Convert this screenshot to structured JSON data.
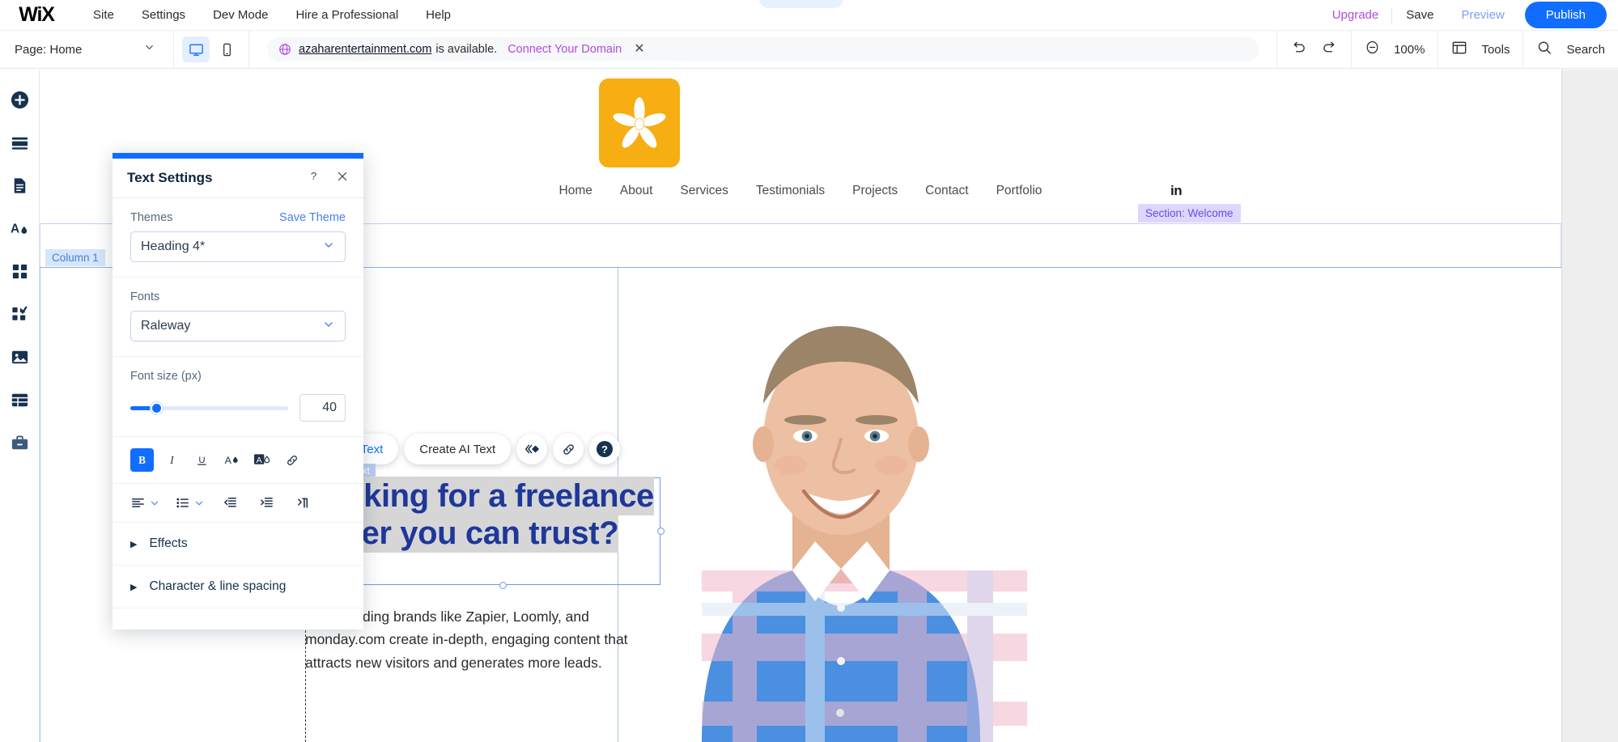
{
  "app": {
    "brand": "WiX",
    "accent_blue": "#116dff",
    "accent_purple": "#b14adb"
  },
  "topbar": {
    "menu": [
      "Site",
      "Settings",
      "Dev Mode",
      "Hire a Professional",
      "Help"
    ],
    "upgrade": "Upgrade",
    "save": "Save",
    "preview": "Preview",
    "publish": "Publish"
  },
  "toolbar": {
    "page_label": "Page: Home",
    "domain": {
      "name": "azaharentertainment.com",
      "status": "is available.",
      "cta": "Connect Your Domain"
    },
    "zoom": "100%",
    "tools": "Tools",
    "search": "Search"
  },
  "left_rail": [
    {
      "name": "add-icon"
    },
    {
      "name": "sections-icon"
    },
    {
      "name": "pages-icon"
    },
    {
      "name": "theme-icon"
    },
    {
      "name": "apps-icon"
    },
    {
      "name": "my-designs-icon"
    },
    {
      "name": "media-icon"
    },
    {
      "name": "cms-icon"
    },
    {
      "name": "business-icon"
    }
  ],
  "panel": {
    "title": "Text Settings",
    "themes_label": "Themes",
    "save_theme": "Save Theme",
    "theme_value": "Heading 4*",
    "fonts_label": "Fonts",
    "font_value": "Raleway",
    "font_size_label": "Font size (px)",
    "font_size_value": "40",
    "format_buttons": [
      "bold",
      "italic",
      "underline",
      "text-color",
      "text-highlight",
      "link"
    ],
    "bold_active": true,
    "align_buttons": [
      "align",
      "align-dropdown",
      "list",
      "list-dropdown",
      "decrease-indent",
      "increase-indent",
      "text-direction"
    ],
    "accordions": [
      "Effects",
      "Character & line spacing"
    ]
  },
  "canvas": {
    "section_badge": "Section: Welcome",
    "column_badge": "Column 1",
    "element_tag": "Text",
    "site_nav": [
      "Home",
      "About",
      "Services",
      "Testimonials",
      "Projects",
      "Contact",
      "Portfolio"
    ],
    "social": "in",
    "logo_color": "#f7ae13",
    "text_toolbar": {
      "edit_text": "Edit Text",
      "create_ai_text": "Create AI Text",
      "icons": [
        "animation-icon",
        "link-icon",
        "help-icon"
      ]
    },
    "heading": "Looking for a freelance writer you can trust?",
    "heading_color": "#1e3799",
    "body": "I help leading brands like Zapier, Loomly, and monday.com create in-depth, engaging content that attracts new visitors and generates more leads."
  }
}
